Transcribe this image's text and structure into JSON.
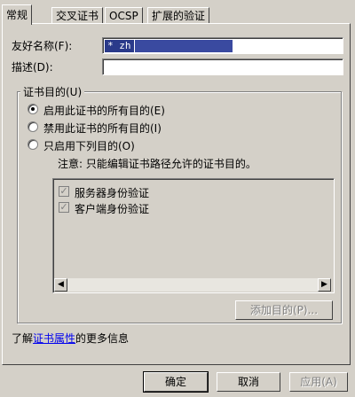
{
  "tabs": [
    {
      "label": "常规",
      "active": true
    },
    {
      "label": "交叉证书",
      "active": false
    },
    {
      "label": "OCSP",
      "active": false
    },
    {
      "label": "扩展的验证",
      "active": false
    }
  ],
  "general": {
    "friendly_name_label": "友好名称(F):",
    "friendly_name_value": "* zh",
    "description_label": "描述(D):",
    "description_value": ""
  },
  "purposes": {
    "group_title": "证书目的(U)",
    "options": [
      {
        "label": "启用此证书的所有目的(E)",
        "selected": true
      },
      {
        "label": "禁用此证书的所有目的(I)",
        "selected": false
      },
      {
        "label": "只启用下列目的(O)",
        "selected": false
      }
    ],
    "note": "注意: 只能编辑证书路径允许的证书目的。",
    "items": [
      {
        "label": "服务器身份验证",
        "checked": true
      },
      {
        "label": "客户端身份验证",
        "checked": true
      }
    ],
    "add_button": "添加目的(P)..."
  },
  "footer": {
    "learn_prefix": "了解",
    "learn_link": "证书属性",
    "learn_suffix": "的更多信息"
  },
  "buttons": {
    "ok": "确定",
    "cancel": "取消",
    "apply": "应用(A)"
  },
  "icons": {
    "scroll_left": "triangle-left",
    "scroll_right": "triangle-right",
    "check": "check-mark"
  },
  "colors": {
    "window_bg": "#d4d0c8",
    "selection": "#2a3a8a",
    "link": "#0000ee"
  }
}
